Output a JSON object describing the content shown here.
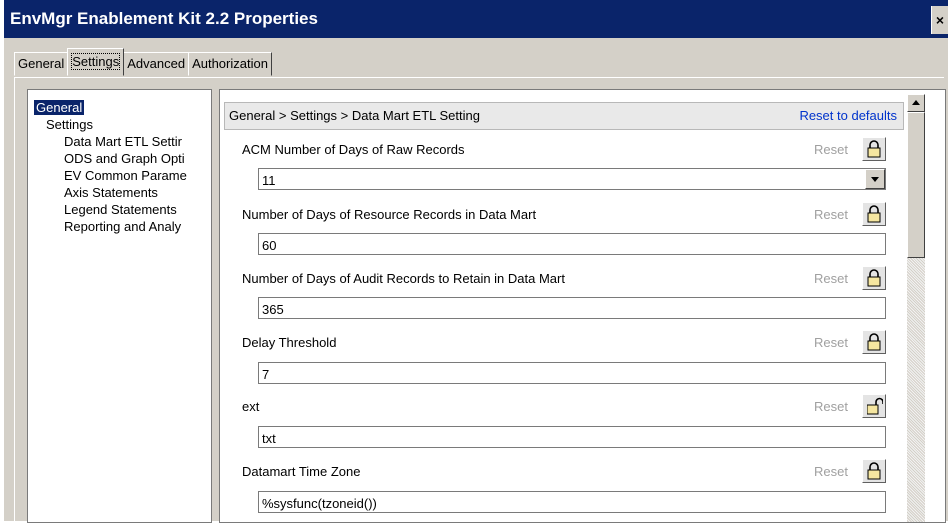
{
  "window": {
    "title": "EnvMgr Enablement Kit 2.2 Properties",
    "close_glyph": "×"
  },
  "tabs": [
    {
      "label": "General"
    },
    {
      "label": "Settings"
    },
    {
      "label": "Advanced"
    },
    {
      "label": "Authorization"
    }
  ],
  "active_tab": "Settings",
  "tree": {
    "items": [
      {
        "label": "General",
        "selected": true
      },
      {
        "label": "Settings"
      },
      {
        "label": "Data Mart ETL Settir"
      },
      {
        "label": "ODS and Graph Opti"
      },
      {
        "label": "EV Common Parame"
      },
      {
        "label": "Axis Statements"
      },
      {
        "label": "Legend Statements"
      },
      {
        "label": "Reporting and Analy"
      }
    ]
  },
  "content": {
    "breadcrumb": "General > Settings > Data Mart ETL Setting",
    "reset_defaults": "Reset to defaults",
    "settings": [
      {
        "label": "ACM Number of Days of Raw Records",
        "value": "11",
        "reset": "Reset",
        "lock_icon": "lock-closed-icon",
        "has_dropdown": true
      },
      {
        "label": "Number of Days of Resource Records in Data Mart",
        "value": "60",
        "reset": "Reset",
        "lock_icon": "lock-closed-icon"
      },
      {
        "label": "Number of Days of Audit Records to Retain in Data Mart",
        "value": "365",
        "reset": "Reset",
        "lock_icon": "lock-closed-icon"
      },
      {
        "label": "Delay Threshold",
        "value": "7",
        "reset": "Reset",
        "lock_icon": "lock-closed-icon"
      },
      {
        "label": "ext",
        "value": "txt",
        "reset": "Reset",
        "lock_icon": "lock-open-icon"
      },
      {
        "label": "Datamart Time Zone",
        "value": "%sysfunc(tzoneid())",
        "reset": "Reset",
        "lock_icon": "lock-closed-icon"
      }
    ]
  },
  "colors": {
    "titlebar": "#0a246a",
    "link": "#0033cc",
    "reset_text": "#a0a0a0"
  }
}
